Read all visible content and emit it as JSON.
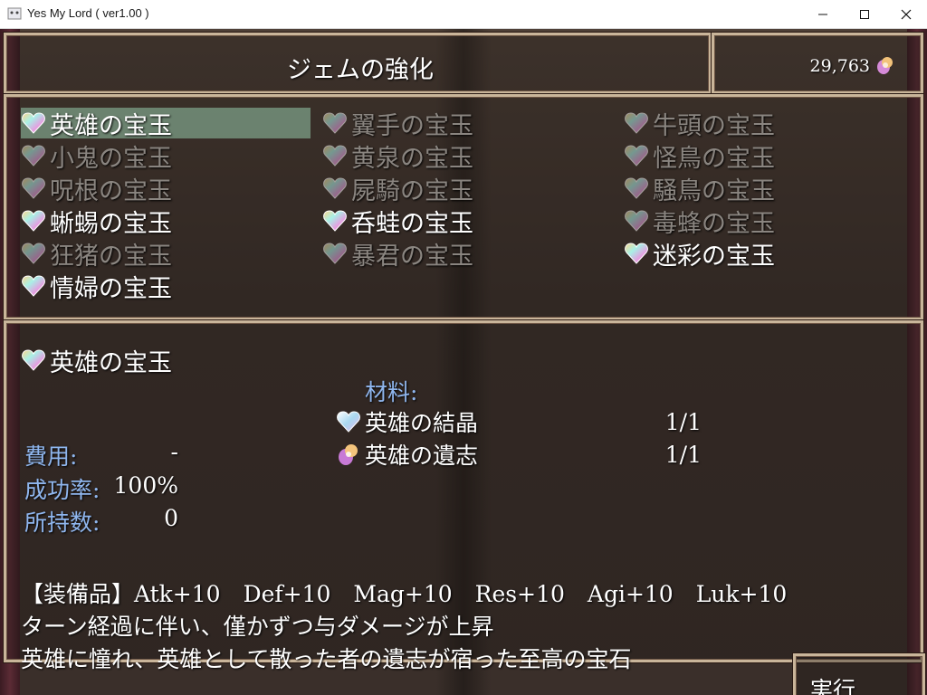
{
  "window": {
    "title": "Yes My Lord ( ver1.00 )"
  },
  "header": {
    "title": "ジェムの強化",
    "gold": "29,763"
  },
  "gems": [
    {
      "label": "英雄の宝玉",
      "col": 0,
      "row": 0,
      "enabled": true,
      "selected": true
    },
    {
      "label": "小鬼の宝玉",
      "col": 0,
      "row": 1,
      "enabled": false
    },
    {
      "label": "呪根の宝玉",
      "col": 0,
      "row": 2,
      "enabled": false
    },
    {
      "label": "蜥蜴の宝玉",
      "col": 0,
      "row": 3,
      "enabled": true
    },
    {
      "label": "狂猪の宝玉",
      "col": 0,
      "row": 4,
      "enabled": false
    },
    {
      "label": "情婦の宝玉",
      "col": 0,
      "row": 5,
      "enabled": true
    },
    {
      "label": "翼手の宝玉",
      "col": 1,
      "row": 0,
      "enabled": false
    },
    {
      "label": "黄泉の宝玉",
      "col": 1,
      "row": 1,
      "enabled": false
    },
    {
      "label": "屍騎の宝玉",
      "col": 1,
      "row": 2,
      "enabled": false
    },
    {
      "label": "呑蛙の宝玉",
      "col": 1,
      "row": 3,
      "enabled": true
    },
    {
      "label": "暴君の宝玉",
      "col": 1,
      "row": 4,
      "enabled": false
    },
    {
      "label": "牛頭の宝玉",
      "col": 2,
      "row": 0,
      "enabled": false
    },
    {
      "label": "怪鳥の宝玉",
      "col": 2,
      "row": 1,
      "enabled": false
    },
    {
      "label": "騒鳥の宝玉",
      "col": 2,
      "row": 2,
      "enabled": false
    },
    {
      "label": "毒蜂の宝玉",
      "col": 2,
      "row": 3,
      "enabled": false
    },
    {
      "label": "迷彩の宝玉",
      "col": 2,
      "row": 4,
      "enabled": true
    }
  ],
  "detail": {
    "name": "英雄の宝玉",
    "cost_label": "費用:",
    "cost_value": "-",
    "rate_label": "成功率:",
    "rate_value": "100%",
    "owned_label": "所持数:",
    "owned_value": "0",
    "materials_label": "材料:",
    "materials": [
      {
        "name": "英雄の結晶",
        "qty": "1/1",
        "icon": "crystal-gem-icon"
      },
      {
        "name": "英雄の遺志",
        "qty": "1/1",
        "icon": "bead-icon"
      }
    ],
    "equip_line": "【装備品】Atk+10　Def+10　Mag+10　Res+10　Agi+10　Luk+10",
    "desc_line1": "ターン経過に伴い、僅かずつ与ダメージが上昇",
    "desc_line2": "英雄に憧れ、英雄として散った者の遺志が宿った至高の宝石"
  },
  "exec_label": "実行",
  "colors": {
    "label_blue": "#8fb6ee",
    "highlight": "#7fb49a",
    "frame": "#c9b59a"
  }
}
